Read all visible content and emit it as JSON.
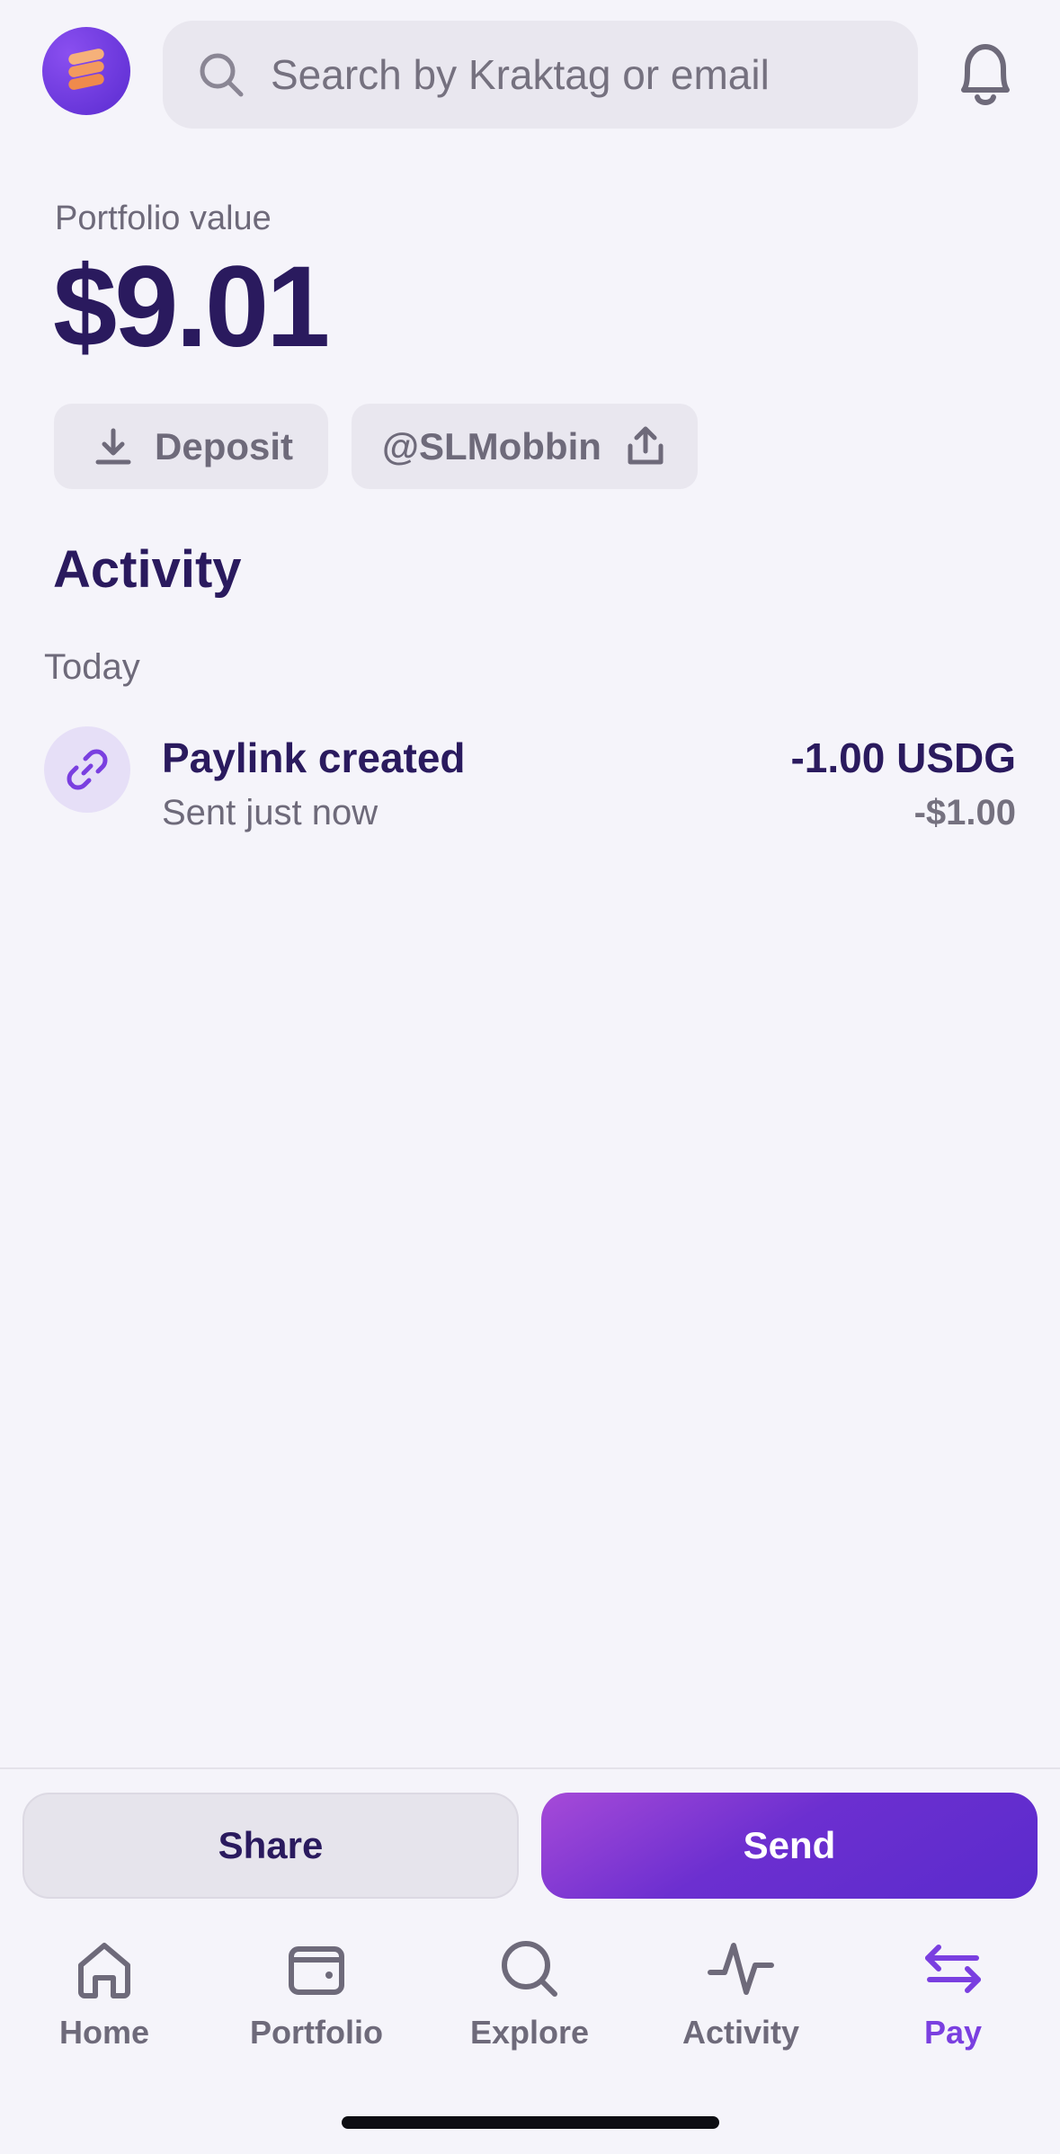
{
  "header": {
    "avatar_icon": "stacked-coins-logo",
    "search": {
      "placeholder": "Search by Kraktag or email",
      "icon": "search-icon"
    },
    "notifications_icon": "bell-icon"
  },
  "portfolio": {
    "label": "Portfolio value",
    "value": "$9.01",
    "deposit_label": "Deposit",
    "tag_label": "@SLMobbin"
  },
  "activity": {
    "title": "Activity",
    "groups": [
      {
        "day": "Today",
        "items": [
          {
            "icon": "link-icon",
            "title": "Paylink created",
            "subtitle": "Sent just now",
            "amount": "-1.00 USDG",
            "fiat": "-$1.00"
          }
        ]
      }
    ]
  },
  "actions": {
    "share_label": "Share",
    "send_label": "Send"
  },
  "nav": {
    "items": [
      {
        "label": "Home",
        "icon": "home-icon"
      },
      {
        "label": "Portfolio",
        "icon": "wallet-icon"
      },
      {
        "label": "Explore",
        "icon": "search-icon"
      },
      {
        "label": "Activity",
        "icon": "activity-icon"
      },
      {
        "label": "Pay",
        "icon": "transfer-arrows-icon",
        "active": true
      }
    ]
  },
  "colors": {
    "background": "#f5f4fa",
    "primary_text": "#2a1a5e",
    "secondary_text": "#6e6a7a",
    "accent": "#7a3fe0"
  }
}
